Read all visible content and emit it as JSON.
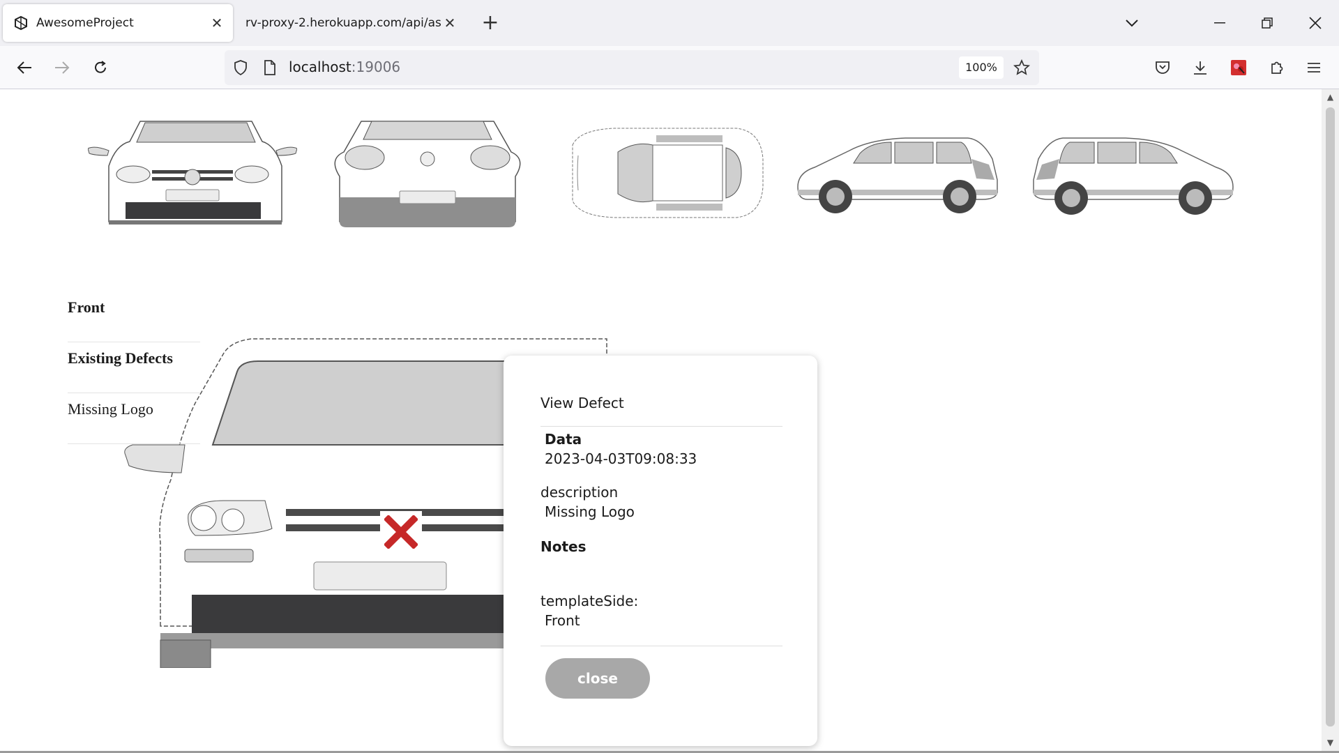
{
  "browser": {
    "tabs": [
      {
        "title": "AwesomeProject",
        "active": true
      },
      {
        "title": "rv-proxy-2.herokuapp.com/api/asse",
        "active": false
      }
    ],
    "url_host": "localhost",
    "url_port": ":19006",
    "zoom": "100%"
  },
  "thumbnails": [
    {
      "name": "front-view"
    },
    {
      "name": "rear-view"
    },
    {
      "name": "top-view"
    },
    {
      "name": "left-side-view"
    },
    {
      "name": "right-side-view"
    }
  ],
  "sidebar": {
    "heading": "Front",
    "section": "Existing Defects",
    "items": [
      "Missing Logo"
    ]
  },
  "modal": {
    "title": "View Defect",
    "data_label": "Data",
    "data_value": "2023-04-03T09:08:33",
    "description_label": "description",
    "description_value": "Missing Logo",
    "notes_label": "Notes",
    "template_side_label": "templateSide:",
    "template_side_value": "Front",
    "close_label": "close"
  },
  "colors": {
    "defect_marker": "#c62828",
    "close_button": "#a8a8a8"
  }
}
